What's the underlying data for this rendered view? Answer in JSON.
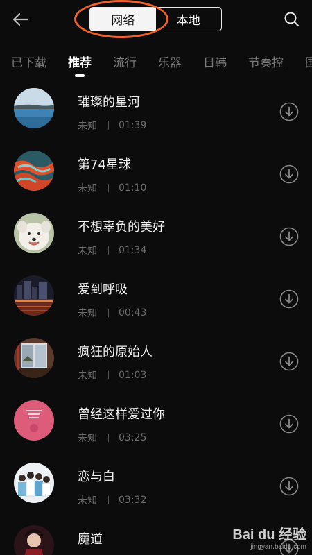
{
  "header": {
    "toggle": {
      "network_label": "网络",
      "local_label": "本地"
    }
  },
  "tabs": [
    "已下载",
    "推荐",
    "流行",
    "乐器",
    "日韩",
    "节奏控",
    "国"
  ],
  "songs": [
    {
      "title": "璀璨的星河",
      "source": "未知",
      "duration": "01:39"
    },
    {
      "title": "第74星球",
      "source": "未知",
      "duration": "01:10"
    },
    {
      "title": "不想辜负的美好",
      "source": "未知",
      "duration": "01:34"
    },
    {
      "title": "爱到呼吸",
      "source": "未知",
      "duration": "00:43"
    },
    {
      "title": "疯狂的原始人",
      "source": "未知",
      "duration": "01:03"
    },
    {
      "title": "曾经这样爱过你",
      "source": "未知",
      "duration": "03:25"
    },
    {
      "title": "恋与白",
      "source": "未知",
      "duration": "03:32"
    },
    {
      "title": "魔道",
      "source": "",
      "duration": ""
    }
  ],
  "watermark": {
    "logo": "Bai du 经验",
    "url": "jingyan.baidu.com"
  },
  "colors": {
    "annotation": "#f0612a",
    "background": "#0c0c0c"
  }
}
